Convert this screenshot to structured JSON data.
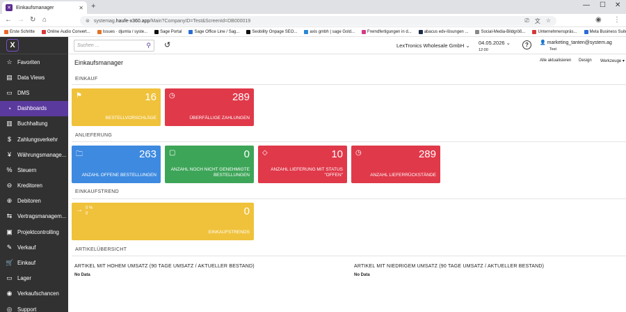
{
  "browser": {
    "tab_title": "Einkaufsmanager",
    "url_prefix": "systemag.",
    "url_host": "haufe-x360.app",
    "url_path": "/Main?CompanyID=Test&ScreenId=DB000019",
    "bookmarks": [
      {
        "label": "Erste Schritte",
        "color": "#e8672b"
      },
      {
        "label": "Online Audio Convert...",
        "color": "#d93a3a"
      },
      {
        "label": "Issues · djumla / syste...",
        "color": "#e27328"
      },
      {
        "label": "Sage Portal",
        "color": "#111111"
      },
      {
        "label": "Sage Office Line / Sag...",
        "color": "#2b6cd4"
      },
      {
        "label": "Seobility Onpage SEO...",
        "color": "#111111"
      },
      {
        "label": "axis gmbh | sage Gold...",
        "color": "#2b87d4"
      },
      {
        "label": "Fremdfertigungen in d...",
        "color": "#d43a8a"
      },
      {
        "label": "abacus edv-lösungen ...",
        "color": "#1c2a4a"
      },
      {
        "label": "Social-Media-Bildgröß...",
        "color": "#888888"
      },
      {
        "label": "Unternehmenspräs...",
        "color": "#d43a3a"
      },
      {
        "label": "Meta Business Suite",
        "color": "#2b6cd4"
      }
    ]
  },
  "sidebar": {
    "items": [
      {
        "label": "Favoriten",
        "icon": "☆"
      },
      {
        "label": "Data Views",
        "icon": "▤"
      },
      {
        "label": "DMS",
        "icon": "▭"
      },
      {
        "label": "Dashboards",
        "icon": "◔"
      },
      {
        "label": "Buchhaltung",
        "icon": "▥"
      },
      {
        "label": "Zahlungsverkehr",
        "icon": "$"
      },
      {
        "label": "Währungsmanage...",
        "icon": "¥"
      },
      {
        "label": "Steuern",
        "icon": "%"
      },
      {
        "label": "Kreditoren",
        "icon": "⊖"
      },
      {
        "label": "Debitoren",
        "icon": "⊕"
      },
      {
        "label": "Vertragsmanagem...",
        "icon": "⇆"
      },
      {
        "label": "Projektcontrolling",
        "icon": "▣"
      },
      {
        "label": "Verkauf",
        "icon": "✎"
      },
      {
        "label": "Einkauf",
        "icon": "🛒"
      },
      {
        "label": "Lager",
        "icon": "▭"
      },
      {
        "label": "Verkaufschancen",
        "icon": "◉"
      },
      {
        "label": "Support",
        "icon": "◎"
      }
    ]
  },
  "topbar": {
    "search_placeholder": "Suchen ...",
    "company": "LexTronics Wholesale GmbH",
    "date": "04.05.2026",
    "time": "12:00",
    "user": "marketing_tanten@system.ag",
    "user_sub": "Test"
  },
  "page": {
    "title": "Einkaufsmanager",
    "refresh_all": "Alle aktualisieren",
    "design": "Design",
    "tools": "Werkzeuge"
  },
  "sections": {
    "einkauf": "EINKAUF",
    "anlieferung": "ANLIEFERUNG",
    "einkaufstrend": "EINKAUFSTREND",
    "artikel": "ARTIKELÜBERSICHT"
  },
  "tiles": {
    "bestellvorschlaege": {
      "value": "16",
      "label": "BESTELLVORSCHLÄGE",
      "color": "#f0c23b"
    },
    "ueberfaellig": {
      "value": "289",
      "label": "ÜBERFÄLLIGE ZAHLUNGEN",
      "color": "#e0394a"
    },
    "offene": {
      "value": "263",
      "label": "ANZAHL OFFENE BESTELLUNGEN",
      "color": "#3e8ae0"
    },
    "nicht_genehmigt": {
      "value": "0",
      "label": "ANZAHL NOCH NICHT GENEHMIGTE BESTELLUNGEN",
      "color": "#3da558"
    },
    "lieferung_offen": {
      "value": "10",
      "label": "ANZAHL LIEFERUNG MIT STATUS \"OFFEN\"",
      "color": "#e0394a"
    },
    "rueckstaende": {
      "value": "289",
      "label": "ANZAHL LIEFERRÜCKSTÄNDE",
      "color": "#e0394a"
    },
    "trend": {
      "value": "0",
      "label": "EINKAUFSTRENDS",
      "sub1": "0 %",
      "sub2": "0",
      "color": "#f0c23b"
    }
  },
  "articles": {
    "high_title": "ARTIKEL MIT HOHEM UMSATZ (90 TAGE UMSATZ / AKTUELLER BESTAND)",
    "high_value": "No Data",
    "low_title": "ARTIKEL MIT NIEDRIGEM UMSATZ (90 TAGE UMSATZ / AKTUELLER BESTAND)",
    "low_value": "No Data"
  }
}
